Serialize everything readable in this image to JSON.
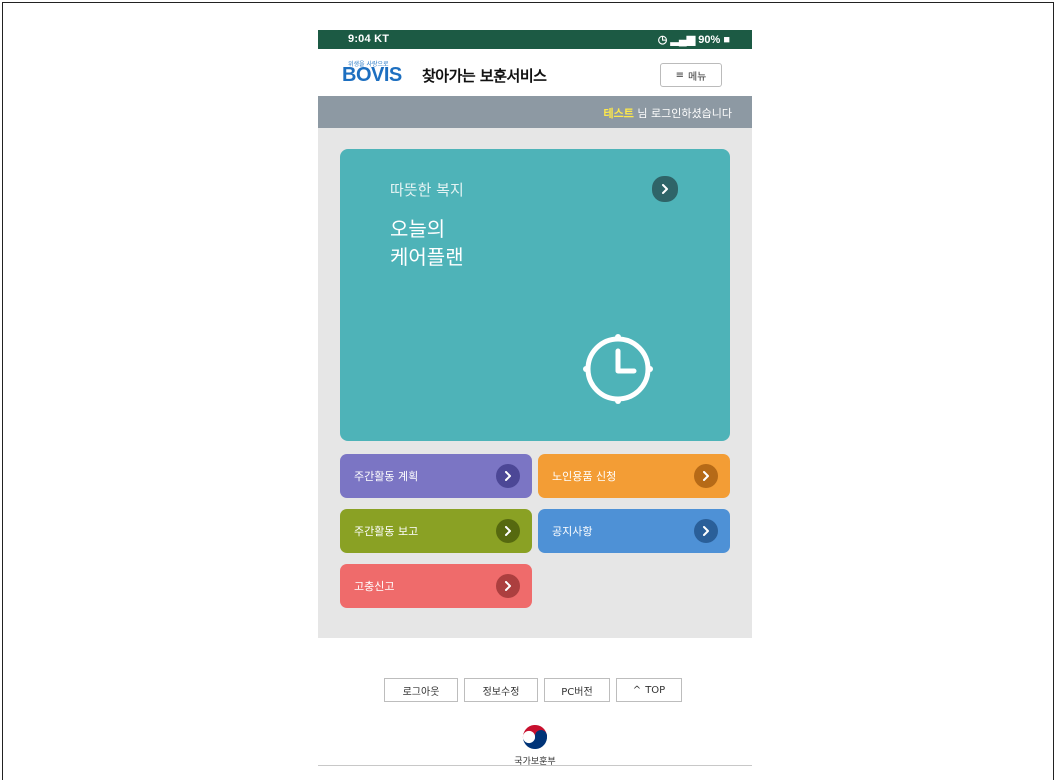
{
  "status_bar": {
    "time": "9:04 KT",
    "right": "90%"
  },
  "header": {
    "logo_small": "위생을 사랑으로",
    "logo": "BOVIS",
    "service_name": "찾아가는 보훈서비스",
    "menu_label": "메뉴"
  },
  "welcome": {
    "user": "테스트",
    "message": " 님 로그인하셨습니다"
  },
  "careplan": {
    "subtitle": "따뜻한 복지",
    "title": "오늘의\n케어플랜"
  },
  "tiles": [
    {
      "label": "주간활동 계획",
      "color": "#7b75c4"
    },
    {
      "label": "노인용품 신청",
      "color": "#f39d35"
    },
    {
      "label": "주간활동 보고",
      "color": "#8aa124"
    },
    {
      "label": "공지사항",
      "color": "#4e91d6"
    },
    {
      "label": "고충신고",
      "color": "#ef6b6b"
    }
  ],
  "footer": {
    "logout": "로그아웃",
    "edit_info": "정보수정",
    "pc_version": "PC버전",
    "top": "TOP"
  },
  "ministry": "국가보훈부",
  "colors": {
    "status_bar": "#1c5a44",
    "welcome_bar": "#8d99a3",
    "careplan": "#4eb3b8",
    "content_bg": "#e6e6e6"
  }
}
